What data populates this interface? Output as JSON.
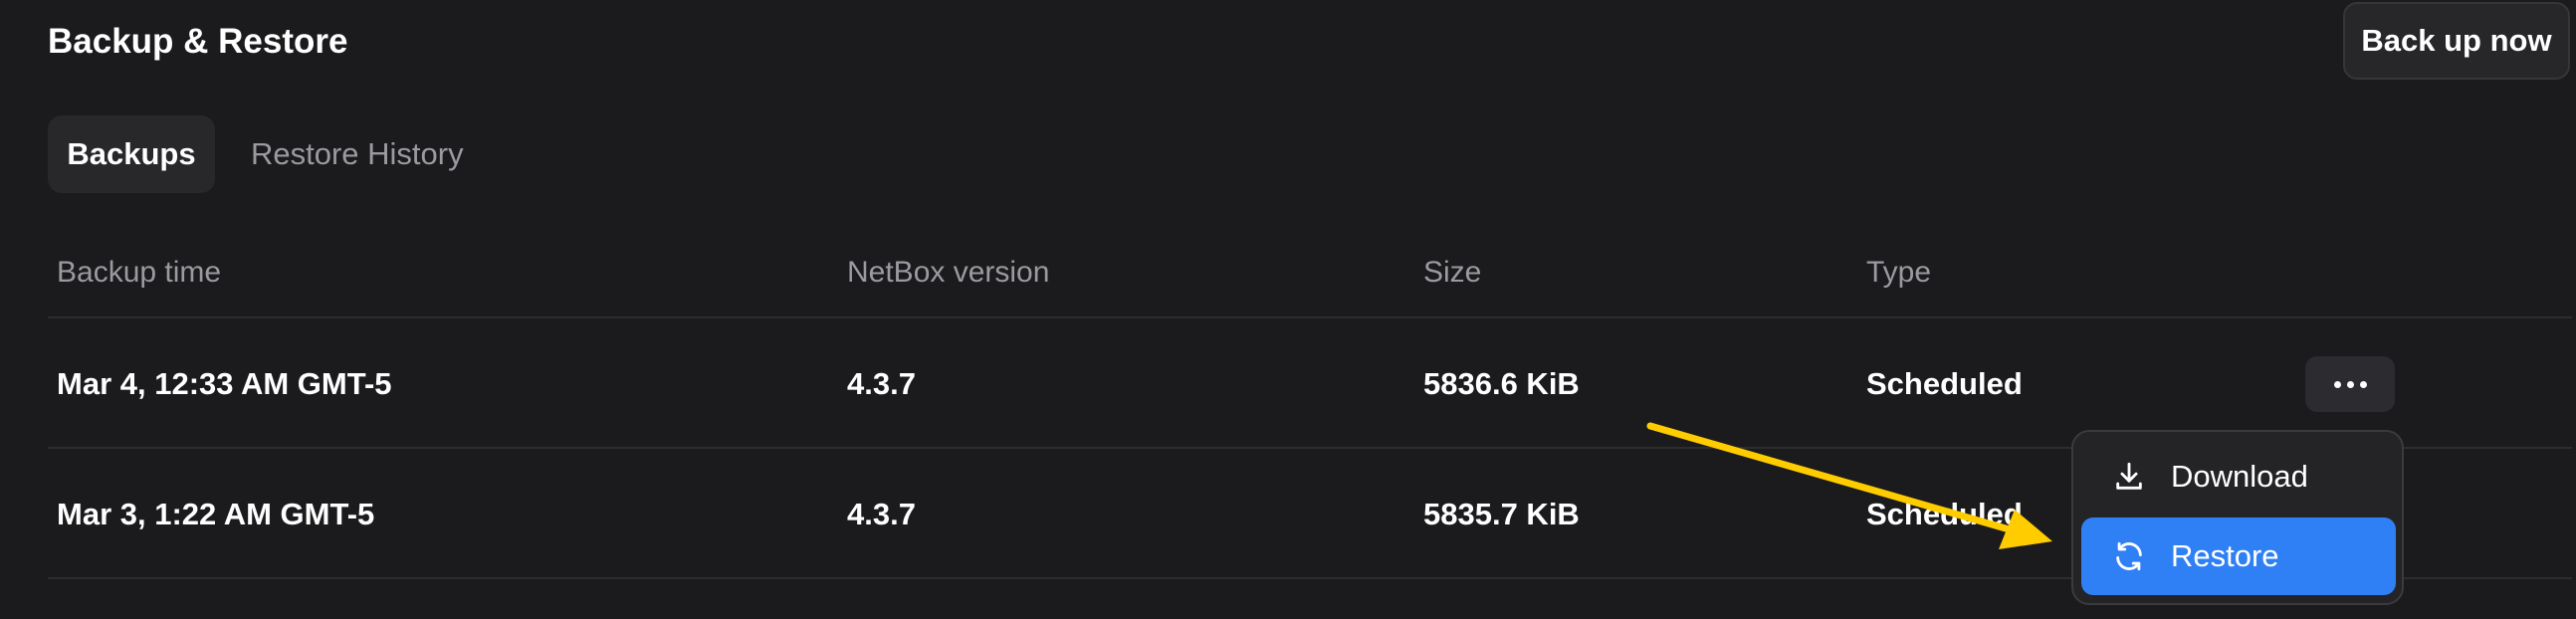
{
  "header": {
    "title": "Backup & Restore",
    "backup_now_label": "Back up now"
  },
  "tabs": [
    {
      "label": "Backups",
      "active": true
    },
    {
      "label": "Restore History",
      "active": false
    }
  ],
  "table": {
    "columns": [
      "Backup time",
      "NetBox version",
      "Size",
      "Type"
    ],
    "rows": [
      {
        "backup_time": "Mar 4, 12:33 AM GMT-5",
        "netbox_version": "4.3.7",
        "size": "5836.6 KiB",
        "type": "Scheduled"
      },
      {
        "backup_time": "Mar 3, 1:22 AM GMT-5",
        "netbox_version": "4.3.7",
        "size": "5835.7 KiB",
        "type": "Scheduled"
      }
    ]
  },
  "row_menu": {
    "trigger_icon": "more-horizontal-icon",
    "items": [
      {
        "label": "Download",
        "icon": "download-icon"
      },
      {
        "label": "Restore",
        "icon": "refresh-icon",
        "highlighted": true
      }
    ]
  },
  "annotation": {
    "icon": "arrow-icon",
    "color": "#ffcc00"
  },
  "colors": {
    "background": "#1b1b1d",
    "accent": "#2f80f5",
    "muted_text": "#9a9aa1"
  }
}
